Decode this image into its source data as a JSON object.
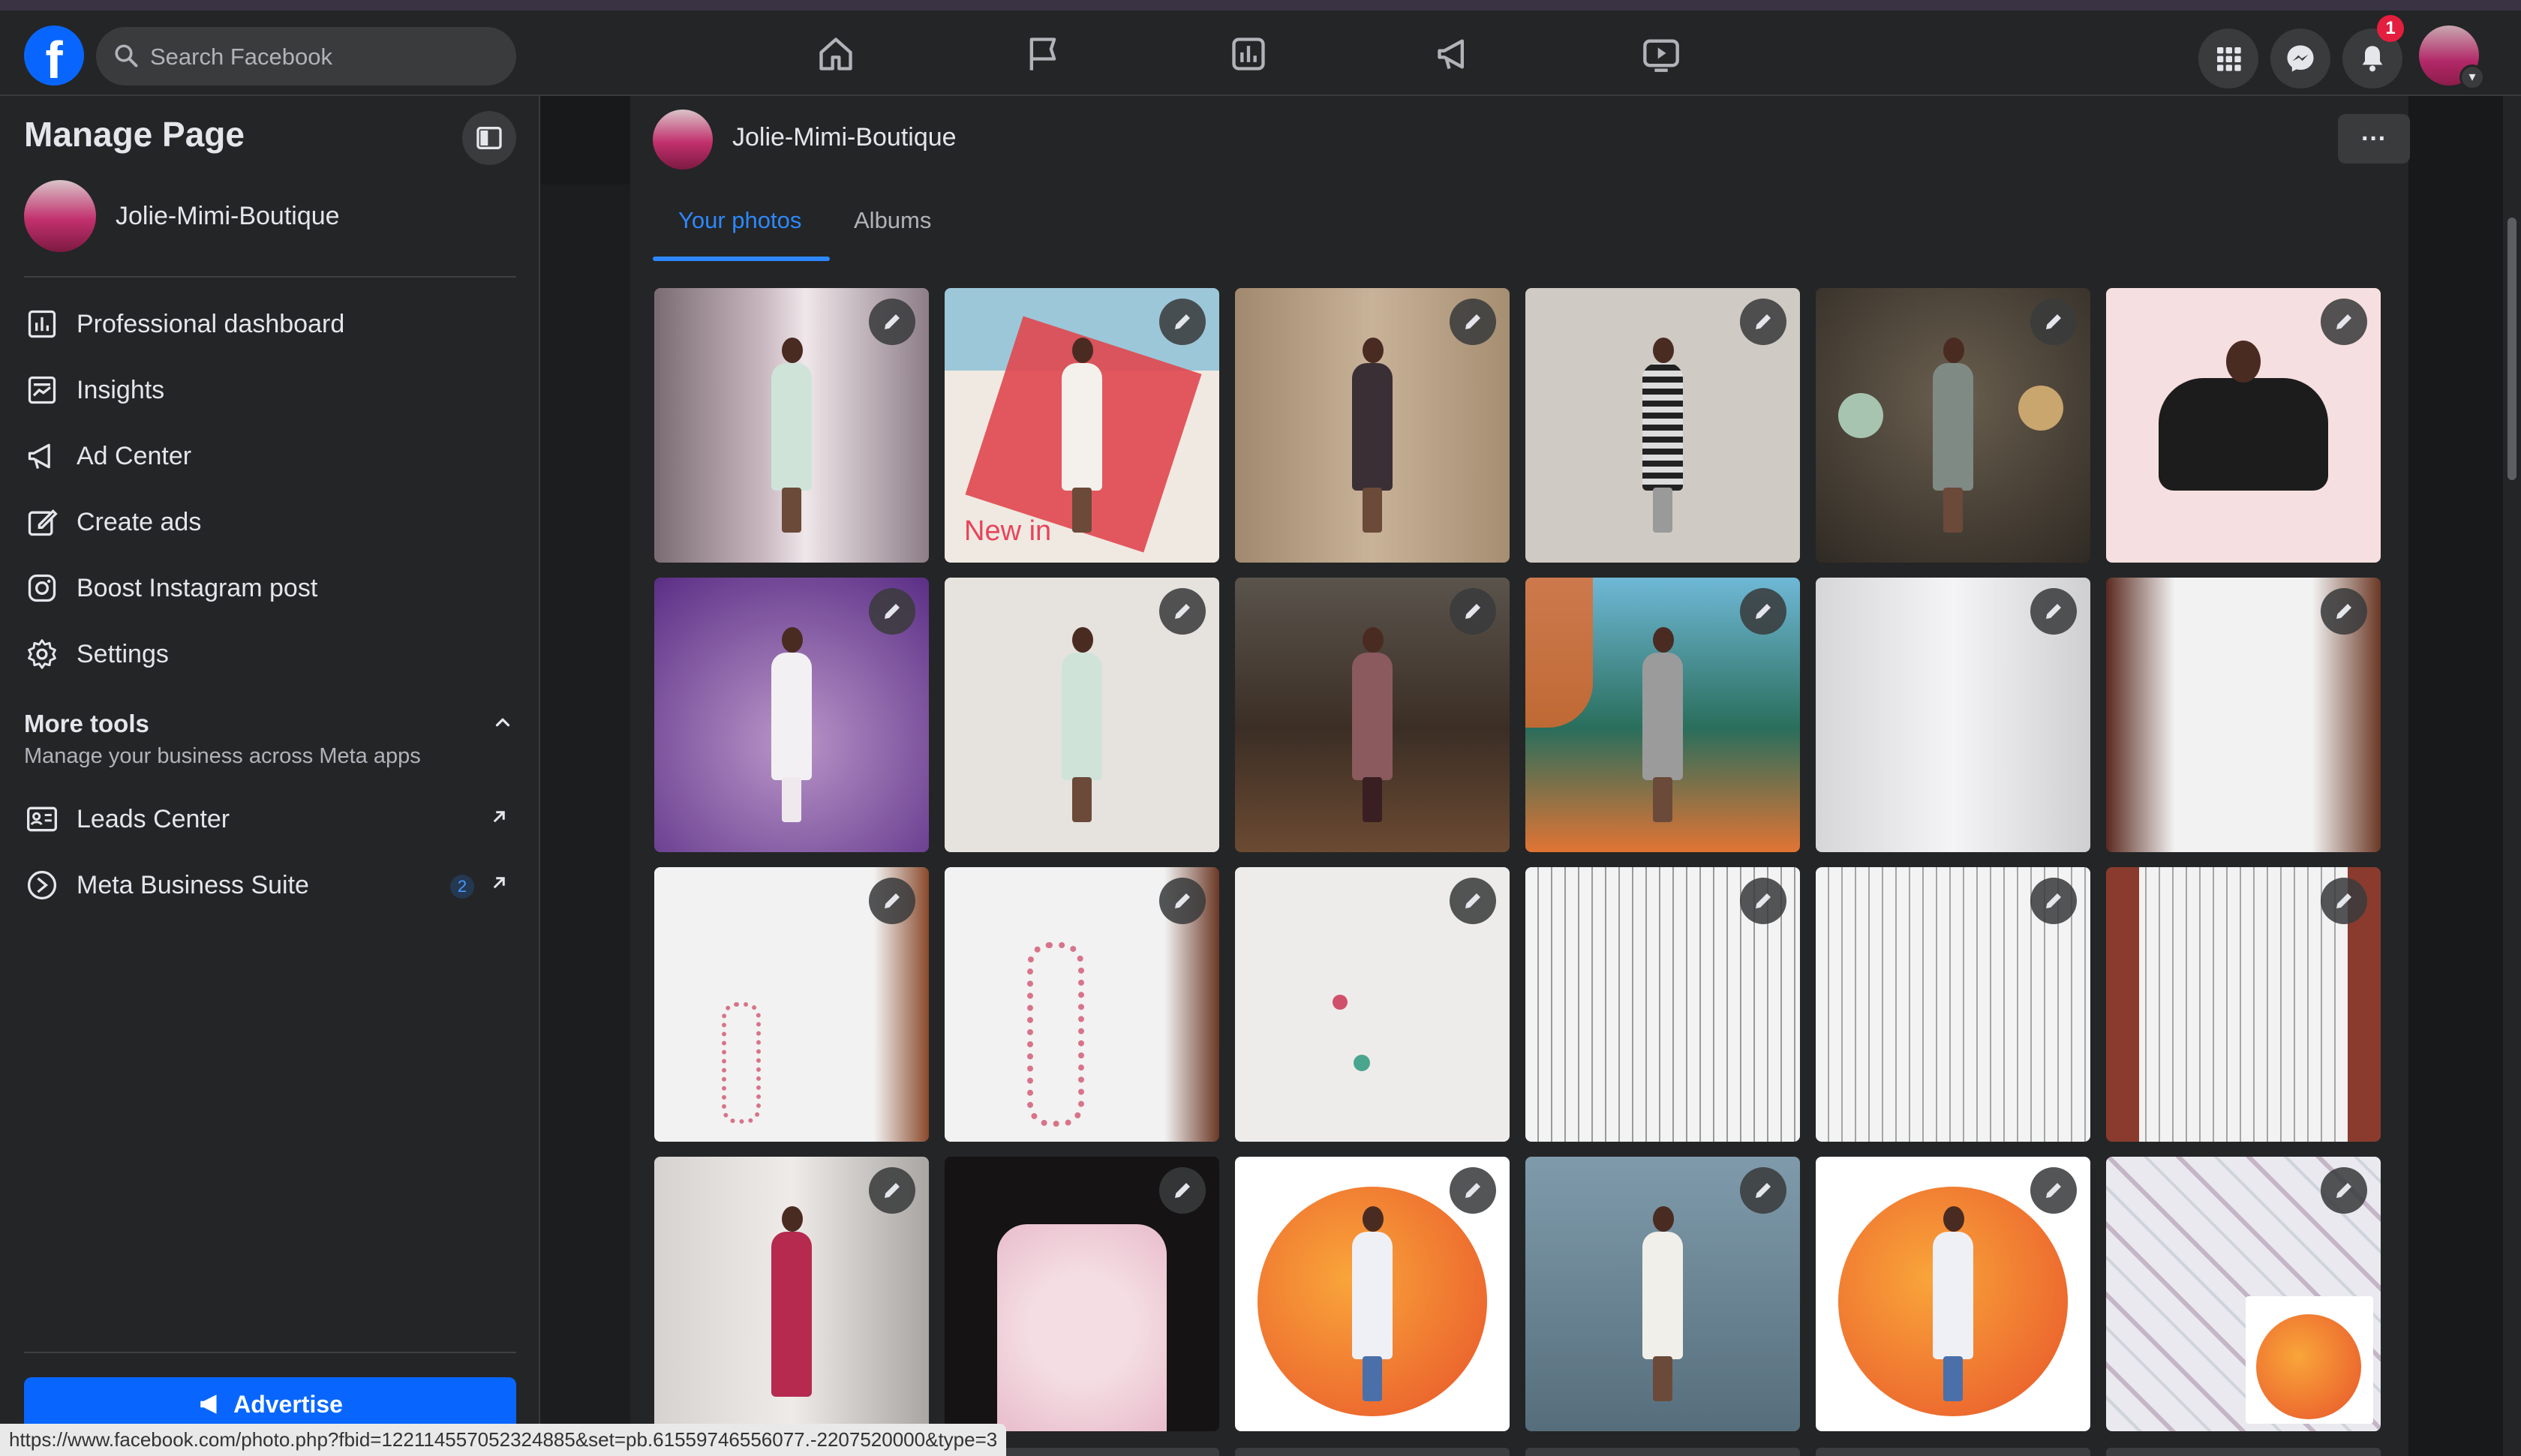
{
  "topnav": {
    "search_placeholder": "Search Facebook",
    "notification_count": "1",
    "nav_icons": [
      "home-icon",
      "flag-icon",
      "insights-icon",
      "megaphone-icon",
      "video-icon"
    ],
    "right_icons": [
      "menu-grid-icon",
      "messenger-icon",
      "bell-icon"
    ]
  },
  "sidebar": {
    "title": "Manage Page",
    "page_name": "Jolie-Mimi-Boutique",
    "items": [
      {
        "label": "Professional dashboard",
        "icon": "dashboard-icon"
      },
      {
        "label": "Insights",
        "icon": "insights-icon"
      },
      {
        "label": "Ad Center",
        "icon": "megaphone-icon"
      },
      {
        "label": "Create ads",
        "icon": "pencil-square-icon"
      },
      {
        "label": "Boost Instagram post",
        "icon": "instagram-icon"
      },
      {
        "label": "Settings",
        "icon": "gear-icon"
      }
    ],
    "more_tools": {
      "title": "More tools",
      "subtitle": "Manage your business across Meta apps",
      "items": [
        {
          "label": "Leads Center",
          "icon": "leads-icon"
        },
        {
          "label": "Meta Business Suite",
          "icon": "meta-business-icon",
          "count": "2"
        }
      ]
    },
    "advertise_label": "Advertise"
  },
  "main": {
    "page_name": "Jolie-Mimi-Boutique",
    "more_label": "···",
    "tabs": [
      {
        "label": "Your photos",
        "active": true
      },
      {
        "label": "Albums",
        "active": false
      }
    ],
    "photo_overlays": {
      "new_in": "New in"
    }
  },
  "status_bar_url": "https://www.facebook.com/photo.php?fbid=122114557052324885&set=pb.61559746556077.-2207520000&type=3",
  "colors": {
    "accent": "#0866ff",
    "tab_active": "#2d88ff",
    "badge": "#e41e3f",
    "surface": "#242526",
    "background": "#18191a"
  }
}
